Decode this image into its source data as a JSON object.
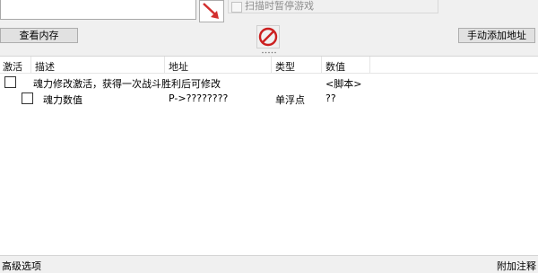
{
  "scan": {
    "pause_game_label": "扫描时暂停游戏"
  },
  "buttons": {
    "memory_view": "查看内存",
    "add_address_manually": "手动添加地址"
  },
  "table": {
    "headers": [
      "激活",
      "描述",
      "地址",
      "类型",
      "数值"
    ],
    "rows": [
      {
        "description": "魂力修改激活，获得一次战斗胜利后可修改",
        "address": "",
        "type": "",
        "value": "<脚本>"
      },
      {
        "description": "魂力数值",
        "address": "P->????????",
        "type": "单浮点",
        "value": "??"
      }
    ]
  },
  "status": {
    "advanced_options": "高级选项",
    "table_extras": "附加注释"
  },
  "icons": {
    "arrow_button": "red-diagonal-arrow-icon",
    "clear_button": "red-no-sign-icon"
  },
  "colors": {
    "arrow_red": "#d32f2f",
    "no_sign_red": "#cc1f1f"
  }
}
